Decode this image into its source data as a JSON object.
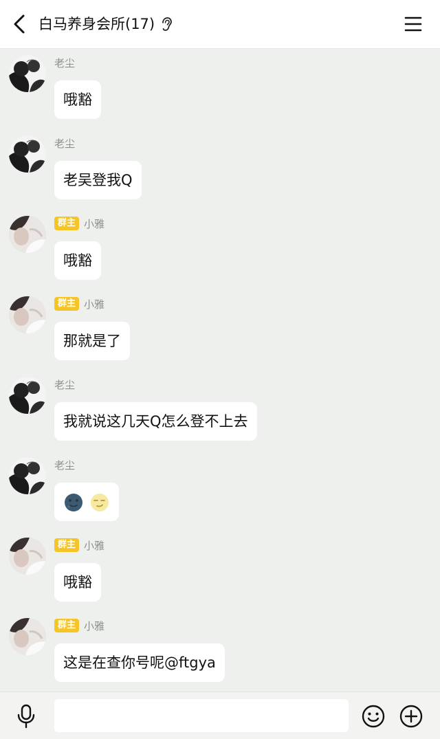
{
  "header": {
    "title": "白马养身会所(17)"
  },
  "messages": [
    {
      "sender": "老尘",
      "badge": "",
      "text": "哦豁",
      "avatar": "manga-avatar"
    },
    {
      "sender": "老尘",
      "badge": "",
      "text": "老吴登我Q",
      "avatar": "manga-avatar"
    },
    {
      "sender": "小雅",
      "badge": "群主",
      "text": "哦豁",
      "avatar": "photo-avatar"
    },
    {
      "sender": "小雅",
      "badge": "群主",
      "text": "那就是了",
      "avatar": "photo-avatar"
    },
    {
      "sender": "老尘",
      "badge": "",
      "text": "我就说这几天Q怎么登不上去",
      "avatar": "manga-avatar"
    },
    {
      "sender": "老尘",
      "badge": "",
      "text": "",
      "emojis": [
        "new-moon-face-icon",
        "crescent-moon-face-icon"
      ],
      "avatar": "manga-avatar"
    },
    {
      "sender": "小雅",
      "badge": "群主",
      "text": "哦豁",
      "avatar": "photo-avatar"
    },
    {
      "sender": "小雅",
      "badge": "群主",
      "text": "这是在查你号呢@ftgya",
      "avatar": "photo-avatar"
    }
  ],
  "input": {
    "value": "",
    "placeholder": ""
  },
  "icons": {
    "back": "back-arrow-icon",
    "ear": "ear-icon",
    "menu": "menu-icon",
    "mic": "microphone-icon",
    "emoji": "emoji-icon",
    "plus": "plus-icon"
  },
  "colors": {
    "background": "#edf0ec",
    "badge": "#f5c426",
    "bubble": "#ffffff"
  }
}
